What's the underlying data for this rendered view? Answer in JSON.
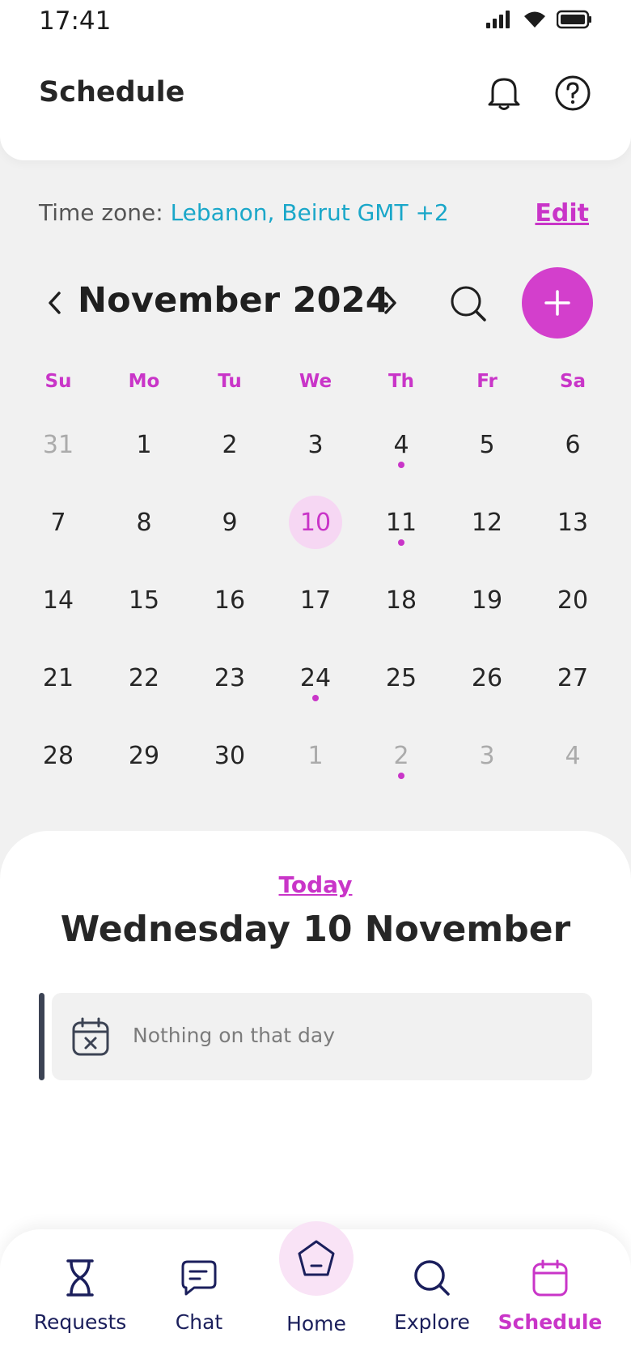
{
  "status_bar": {
    "time": "17:41"
  },
  "header": {
    "title": "Schedule"
  },
  "timezone": {
    "label": "Time zone: ",
    "value": "Lebanon, Beirut GMT +2",
    "edit_label": "Edit"
  },
  "calendar": {
    "month_title": "November 2024",
    "weekdays": [
      "Su",
      "Mo",
      "Tu",
      "We",
      "Th",
      "Fr",
      "Sa"
    ],
    "weeks": [
      [
        {
          "n": "31",
          "muted": true
        },
        {
          "n": "1"
        },
        {
          "n": "2"
        },
        {
          "n": "3"
        },
        {
          "n": "4",
          "dot": true
        },
        {
          "n": "5"
        },
        {
          "n": "6"
        }
      ],
      [
        {
          "n": "7"
        },
        {
          "n": "8"
        },
        {
          "n": "9"
        },
        {
          "n": "10",
          "selected": true
        },
        {
          "n": "11",
          "dot": true
        },
        {
          "n": "12"
        },
        {
          "n": "13"
        }
      ],
      [
        {
          "n": "14"
        },
        {
          "n": "15"
        },
        {
          "n": "16"
        },
        {
          "n": "17"
        },
        {
          "n": "18"
        },
        {
          "n": "19"
        },
        {
          "n": "20"
        }
      ],
      [
        {
          "n": "21"
        },
        {
          "n": "22"
        },
        {
          "n": "23"
        },
        {
          "n": "24",
          "dot": true
        },
        {
          "n": "25"
        },
        {
          "n": "26"
        },
        {
          "n": "27"
        }
      ],
      [
        {
          "n": "28"
        },
        {
          "n": "29"
        },
        {
          "n": "30"
        },
        {
          "n": "1",
          "muted": true
        },
        {
          "n": "2",
          "muted": true,
          "dot": true
        },
        {
          "n": "3",
          "muted": true
        },
        {
          "n": "4",
          "muted": true
        }
      ]
    ]
  },
  "day_panel": {
    "today_label": "Today",
    "date_title": "Wednesday 10 November",
    "empty_message": "Nothing on that day"
  },
  "bottom_nav": {
    "items": [
      {
        "label": "Requests",
        "icon": "hourglass-icon"
      },
      {
        "label": "Chat",
        "icon": "chat-icon"
      },
      {
        "label": "Home",
        "icon": "home-icon"
      },
      {
        "label": "Explore",
        "icon": "search-icon"
      },
      {
        "label": "Schedule",
        "icon": "calendar-icon",
        "active": true
      }
    ]
  },
  "colors": {
    "accent": "#c935c8",
    "link": "#1aa7c9",
    "nav_text": "#1b1f5c",
    "background": "#f1f1f1"
  }
}
